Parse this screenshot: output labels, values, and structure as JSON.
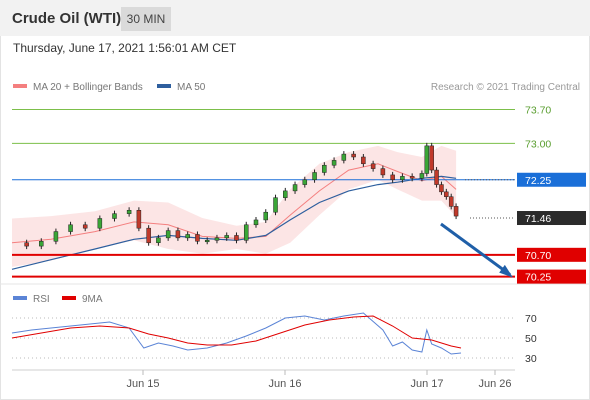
{
  "header": {
    "title": "Crude Oil (WTI)",
    "timeframe": "30 MIN"
  },
  "timestamp": "Thursday, June 17, 2021 1:56:01 AM CET",
  "copyright": "Research © 2021 Trading Central",
  "colors": {
    "bollinger": "#f47f7f",
    "ma50": "#2e5f9e",
    "support": "#e00000",
    "resistance": "#7cbf4a",
    "pivot": "#1a6fd8",
    "rsi": "#5b84d6",
    "rsi_ma": "#e00000",
    "arrow": "#1f5fa8"
  },
  "chart_data": [
    {
      "type": "line",
      "title": "Crude Oil (WTI)",
      "legend": [
        {
          "label": "MA 20 + Bollinger Bands",
          "color": "#f47f7f"
        },
        {
          "label": "MA 50",
          "color": "#2e5f9e"
        }
      ],
      "x_ticks": [
        "Jun 15",
        "Jun 16",
        "Jun 17",
        "Jun 26"
      ],
      "y_ticks": [
        "73.70",
        "73.00",
        "72.25",
        "71.46",
        "70.70",
        "70.25"
      ],
      "levels": [
        {
          "label": "73.70",
          "value": 73.7,
          "kind": "resistance"
        },
        {
          "label": "73.00",
          "value": 73.0,
          "kind": "resistance"
        },
        {
          "label": "72.25",
          "value": 72.25,
          "kind": "pivot"
        },
        {
          "label": "71.46",
          "value": 71.46,
          "kind": "last"
        },
        {
          "label": "70.70",
          "value": 70.7,
          "kind": "support"
        },
        {
          "label": "70.25",
          "value": 70.25,
          "kind": "support"
        }
      ],
      "ylim": [
        70.18,
        74.0
      ],
      "xlim": [
        0,
        1
      ],
      "ma20": [
        [
          0.0,
          70.95
        ],
        [
          0.08,
          71.02
        ],
        [
          0.17,
          71.18
        ],
        [
          0.25,
          71.38
        ],
        [
          0.32,
          71.32
        ],
        [
          0.39,
          71.08
        ],
        [
          0.46,
          71.04
        ],
        [
          0.52,
          71.08
        ],
        [
          0.57,
          71.52
        ],
        [
          0.63,
          72.02
        ],
        [
          0.69,
          72.45
        ],
        [
          0.75,
          72.58
        ],
        [
          0.79,
          72.42
        ],
        [
          0.84,
          72.23
        ],
        [
          0.88,
          72.32
        ],
        [
          0.91,
          72.05
        ]
      ],
      "bb_upper": [
        [
          0.0,
          71.45
        ],
        [
          0.08,
          71.5
        ],
        [
          0.17,
          71.6
        ],
        [
          0.25,
          71.82
        ],
        [
          0.32,
          71.78
        ],
        [
          0.39,
          71.46
        ],
        [
          0.46,
          71.3
        ],
        [
          0.52,
          71.38
        ],
        [
          0.57,
          72.05
        ],
        [
          0.63,
          72.58
        ],
        [
          0.69,
          72.82
        ],
        [
          0.75,
          72.95
        ],
        [
          0.79,
          72.82
        ],
        [
          0.84,
          72.72
        ],
        [
          0.88,
          72.95
        ],
        [
          0.91,
          72.85
        ]
      ],
      "bb_lower": [
        [
          0.0,
          70.45
        ],
        [
          0.08,
          70.58
        ],
        [
          0.17,
          70.82
        ],
        [
          0.25,
          71.0
        ],
        [
          0.32,
          70.82
        ],
        [
          0.39,
          70.72
        ],
        [
          0.46,
          70.82
        ],
        [
          0.52,
          70.72
        ],
        [
          0.57,
          70.95
        ],
        [
          0.63,
          71.52
        ],
        [
          0.69,
          72.05
        ],
        [
          0.75,
          72.25
        ],
        [
          0.79,
          72.05
        ],
        [
          0.84,
          71.82
        ],
        [
          0.88,
          71.82
        ],
        [
          0.91,
          71.48
        ]
      ],
      "ma50": [
        [
          0.0,
          70.4
        ],
        [
          0.08,
          70.6
        ],
        [
          0.17,
          70.82
        ],
        [
          0.25,
          71.02
        ],
        [
          0.32,
          71.1
        ],
        [
          0.39,
          71.04
        ],
        [
          0.46,
          71.0
        ],
        [
          0.52,
          71.1
        ],
        [
          0.57,
          71.42
        ],
        [
          0.63,
          71.78
        ],
        [
          0.69,
          72.02
        ],
        [
          0.75,
          72.15
        ],
        [
          0.79,
          72.2
        ],
        [
          0.84,
          72.28
        ],
        [
          0.88,
          72.32
        ],
        [
          0.91,
          72.28
        ]
      ],
      "close": [
        [
          0.0,
          70.95
        ],
        [
          0.03,
          70.88
        ],
        [
          0.06,
          70.98
        ],
        [
          0.09,
          71.18
        ],
        [
          0.12,
          71.32
        ],
        [
          0.15,
          71.25
        ],
        [
          0.18,
          71.45
        ],
        [
          0.21,
          71.55
        ],
        [
          0.24,
          71.62
        ],
        [
          0.26,
          71.25
        ],
        [
          0.28,
          70.95
        ],
        [
          0.3,
          71.05
        ],
        [
          0.32,
          71.2
        ],
        [
          0.34,
          71.05
        ],
        [
          0.36,
          71.12
        ],
        [
          0.38,
          70.98
        ],
        [
          0.4,
          71.0
        ],
        [
          0.42,
          71.05
        ],
        [
          0.44,
          71.1
        ],
        [
          0.46,
          71.0
        ],
        [
          0.48,
          71.32
        ],
        [
          0.5,
          71.42
        ],
        [
          0.52,
          71.58
        ],
        [
          0.54,
          71.88
        ],
        [
          0.56,
          72.02
        ],
        [
          0.58,
          72.15
        ],
        [
          0.6,
          72.25
        ],
        [
          0.62,
          72.4
        ],
        [
          0.64,
          72.55
        ],
        [
          0.66,
          72.65
        ],
        [
          0.68,
          72.78
        ],
        [
          0.7,
          72.72
        ],
        [
          0.72,
          72.58
        ],
        [
          0.74,
          72.48
        ],
        [
          0.76,
          72.35
        ],
        [
          0.78,
          72.25
        ],
        [
          0.8,
          72.32
        ],
        [
          0.82,
          72.28
        ],
        [
          0.84,
          72.38
        ],
        [
          0.85,
          72.95
        ],
        [
          0.86,
          72.45
        ],
        [
          0.87,
          72.15
        ],
        [
          0.88,
          72.0
        ],
        [
          0.89,
          71.9
        ],
        [
          0.9,
          71.7
        ],
        [
          0.91,
          71.5
        ]
      ],
      "forecast_arrow": [
        [
          0.92,
          71.46
        ],
        [
          1.0,
          70.25
        ]
      ]
    },
    {
      "type": "line",
      "legend": [
        {
          "label": "RSI",
          "color": "#5b84d6"
        },
        {
          "label": "9MA",
          "color": "#e00000"
        }
      ],
      "y_ticks": [
        "70",
        "50",
        "30"
      ],
      "ylim": [
        22,
        82
      ],
      "rsi": [
        [
          0.0,
          55
        ],
        [
          0.04,
          58
        ],
        [
          0.08,
          60
        ],
        [
          0.12,
          62
        ],
        [
          0.16,
          64
        ],
        [
          0.2,
          66
        ],
        [
          0.24,
          60
        ],
        [
          0.27,
          40
        ],
        [
          0.3,
          45
        ],
        [
          0.33,
          42
        ],
        [
          0.36,
          38
        ],
        [
          0.4,
          40
        ],
        [
          0.44,
          45
        ],
        [
          0.48,
          52
        ],
        [
          0.52,
          60
        ],
        [
          0.56,
          70
        ],
        [
          0.6,
          72
        ],
        [
          0.64,
          68
        ],
        [
          0.68,
          72
        ],
        [
          0.72,
          75
        ],
        [
          0.76,
          58
        ],
        [
          0.78,
          42
        ],
        [
          0.8,
          46
        ],
        [
          0.82,
          38
        ],
        [
          0.84,
          36
        ],
        [
          0.85,
          58
        ],
        [
          0.86,
          44
        ],
        [
          0.88,
          40
        ],
        [
          0.9,
          34
        ],
        [
          0.92,
          35
        ]
      ],
      "rsi_9ma": [
        [
          0.0,
          50
        ],
        [
          0.06,
          55
        ],
        [
          0.12,
          60
        ],
        [
          0.18,
          62
        ],
        [
          0.24,
          60
        ],
        [
          0.28,
          54
        ],
        [
          0.32,
          50
        ],
        [
          0.36,
          45
        ],
        [
          0.4,
          43
        ],
        [
          0.45,
          43
        ],
        [
          0.5,
          47
        ],
        [
          0.55,
          55
        ],
        [
          0.6,
          63
        ],
        [
          0.65,
          68
        ],
        [
          0.7,
          71
        ],
        [
          0.74,
          72
        ],
        [
          0.78,
          62
        ],
        [
          0.82,
          50
        ],
        [
          0.86,
          48
        ],
        [
          0.9,
          42
        ],
        [
          0.92,
          40
        ]
      ]
    }
  ]
}
